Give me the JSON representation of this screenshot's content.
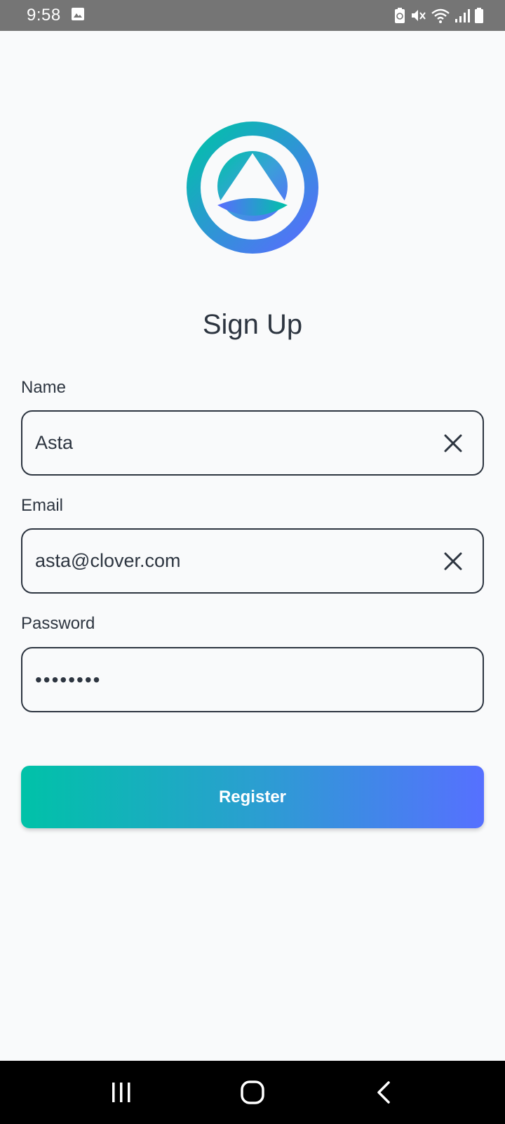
{
  "status_bar": {
    "time": "9:58",
    "icons": [
      "gallery-icon",
      "battery-saver-icon",
      "mute-icon",
      "wifi-icon",
      "signal-icon",
      "battery-icon"
    ]
  },
  "logo": {
    "icon": "app-logo",
    "colors": [
      "#00c2a8",
      "#5670ff"
    ]
  },
  "form": {
    "title": "Sign Up",
    "name": {
      "label": "Name",
      "value": "Asta",
      "clear_icon": "close-icon"
    },
    "email": {
      "label": "Email",
      "value": "asta@clover.com",
      "clear_icon": "close-icon"
    },
    "password": {
      "label": "Password",
      "value": "••••••••"
    },
    "register_label": "Register"
  },
  "nav_bar": {
    "buttons": [
      "recent-apps-icon",
      "home-icon",
      "back-icon"
    ]
  },
  "colors": {
    "background": "#f9fafb",
    "text": "#2d3540",
    "gradient_start": "#00c2a8",
    "gradient_end": "#5670ff",
    "status_bar": "#757575"
  }
}
